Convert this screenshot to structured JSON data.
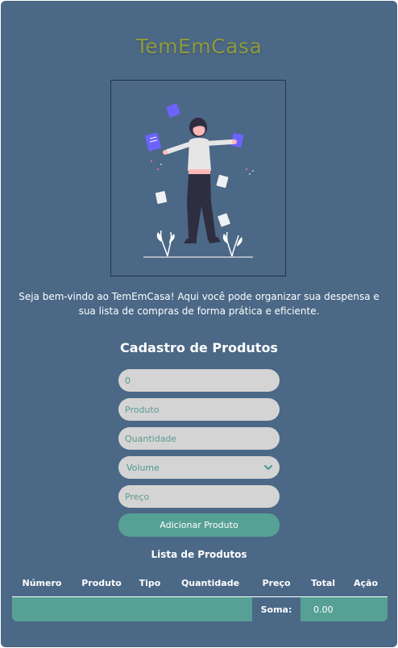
{
  "brand": {
    "name": "TemEmCasa"
  },
  "hero": {
    "image_icon": "woman-juggling-notes-illustration"
  },
  "welcome": {
    "text": "Seja bem-vindo ao TemEmCasa! Aqui você pode organizar sua despensa e sua lista de compras de forma prática e eficiente."
  },
  "form": {
    "title": "Cadastro de Produtos",
    "number_value": "0",
    "product_placeholder": "Produto",
    "quantity_placeholder": "Quantidade",
    "volume_selected": "Volume",
    "price_placeholder": "Preço",
    "add_button_label": "Adicionar Produto"
  },
  "list": {
    "title": "Lista de Produtos",
    "headers": [
      "Número",
      "Produto",
      "Tipo",
      "Quantidade",
      "Preço",
      "Total",
      "Ação"
    ],
    "sum_label": "Soma:",
    "sum_value": "0.00"
  },
  "colors": {
    "background": "#4b6886",
    "brand": "#8e9a3e",
    "accent": "#57a095",
    "field": "#d4d4d4"
  }
}
